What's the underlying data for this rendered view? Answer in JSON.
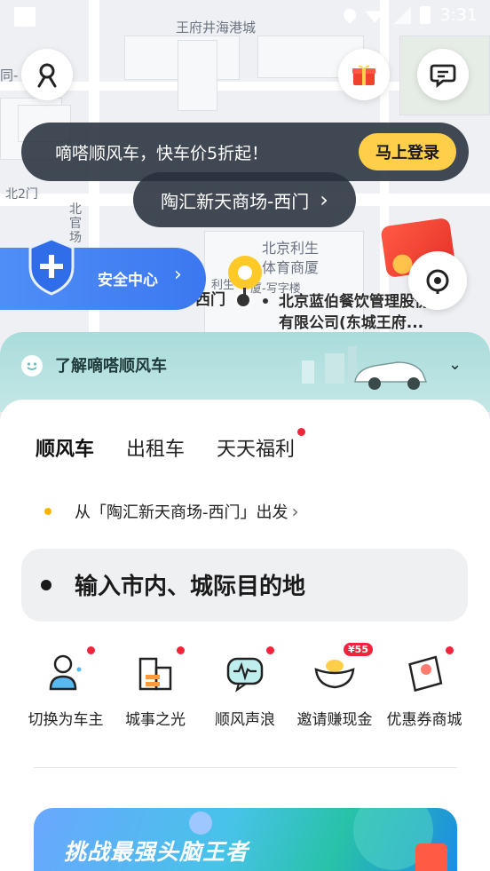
{
  "status_bar": {
    "time": "3:31"
  },
  "map": {
    "labels": [
      "王府井海港城",
      "北京利生",
      "体育商厦",
      "北官场",
      "北2门",
      "同-",
      "利生",
      "厦-写字楼"
    ],
    "poi": [
      "北京蓝伯餐饮管理股份",
      "有限公司(东城王府..."
    ],
    "pin_label": "西门"
  },
  "login_banner": {
    "text": "嘀嗒顺风车，快车价5折起！",
    "button": "马上登录"
  },
  "place_pill": {
    "text": "陶汇新天商场-西门",
    "chevron": "›"
  },
  "safety": {
    "label": "安全中心",
    "chevron": "›"
  },
  "teal_bar": {
    "title": "了解嘀嗒顺风车",
    "chevron": "⌄"
  },
  "tabs": [
    {
      "label": "顺风车"
    },
    {
      "label": "出租车"
    },
    {
      "label": "天天福利"
    }
  ],
  "depart": {
    "text": "从「陶汇新天商场-西门」出发",
    "chevron": "›"
  },
  "destination": {
    "placeholder": "输入市内、城际目的地"
  },
  "features": [
    {
      "label": "切换为车主",
      "icon": "driver-switch-icon"
    },
    {
      "label": "城事之光",
      "icon": "city-buildings-icon"
    },
    {
      "label": "顺风声浪",
      "icon": "voice-wave-icon"
    },
    {
      "label": "邀请赚现金",
      "icon": "gold-ingot-icon",
      "badge": "¥55"
    },
    {
      "label": "优惠券商城",
      "icon": "coupon-icon"
    }
  ],
  "promo": {
    "text": "挑战最强头脑王者"
  },
  "colors": {
    "accent_yellow": "#ffcf4a",
    "safety_blue": "#3b78f0",
    "teal": "#a9dcdb",
    "red_dot": "#f0243b"
  }
}
